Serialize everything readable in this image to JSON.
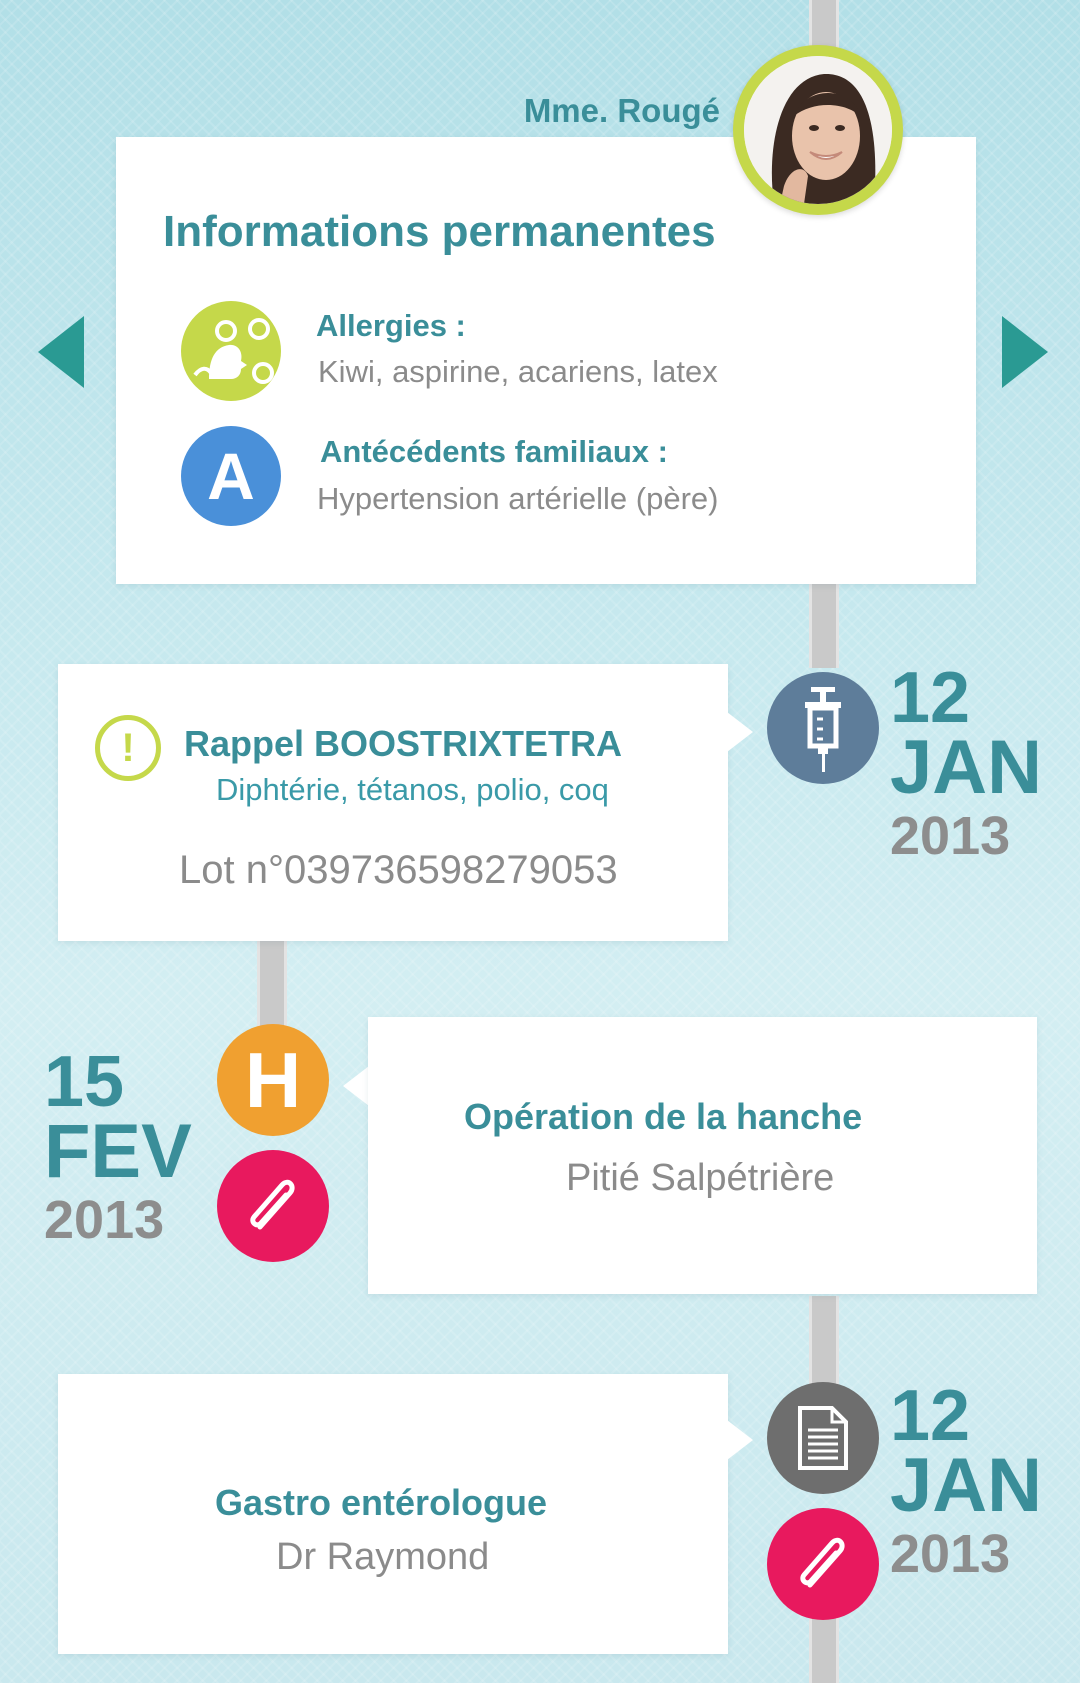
{
  "patient": {
    "name": "Mme. Rougé"
  },
  "permanent": {
    "title": "Informations permanentes",
    "allergies": {
      "label": "Allergies :",
      "value": "Kiwi, aspirine, acariens, latex"
    },
    "family": {
      "label": "Antécédents familiaux :",
      "value": "Hypertension artérielle (père)",
      "icon_letter": "A"
    }
  },
  "events": [
    {
      "title": "Rappel BOOSTRIXTETRA",
      "subtitle": "Diphtérie, tétanos, polio, coq",
      "detail": "Lot n°039736598279053",
      "date": {
        "day": "12",
        "month": "JAN",
        "year": "2013"
      },
      "icon": "syringe-icon"
    },
    {
      "title": "Opération de la hanche",
      "subtitle": "Pitié Salpétrière",
      "date": {
        "day": "15",
        "month": "FEV",
        "year": "2013"
      },
      "icon": "hospital-icon",
      "icon_letter": "H"
    },
    {
      "title": "Gastro entérologue",
      "subtitle": "Dr Raymond",
      "date": {
        "day": "12",
        "month": "JAN",
        "year": "2013"
      },
      "icon": "document-icon"
    }
  ],
  "colors": {
    "teal": "#3a8e99",
    "lime": "#c5d84a",
    "blue": "#4a90d9",
    "slate": "#5e7d9a",
    "orange": "#f0a030",
    "pink": "#e8195e",
    "dark_grey": "#6e6e6e"
  }
}
